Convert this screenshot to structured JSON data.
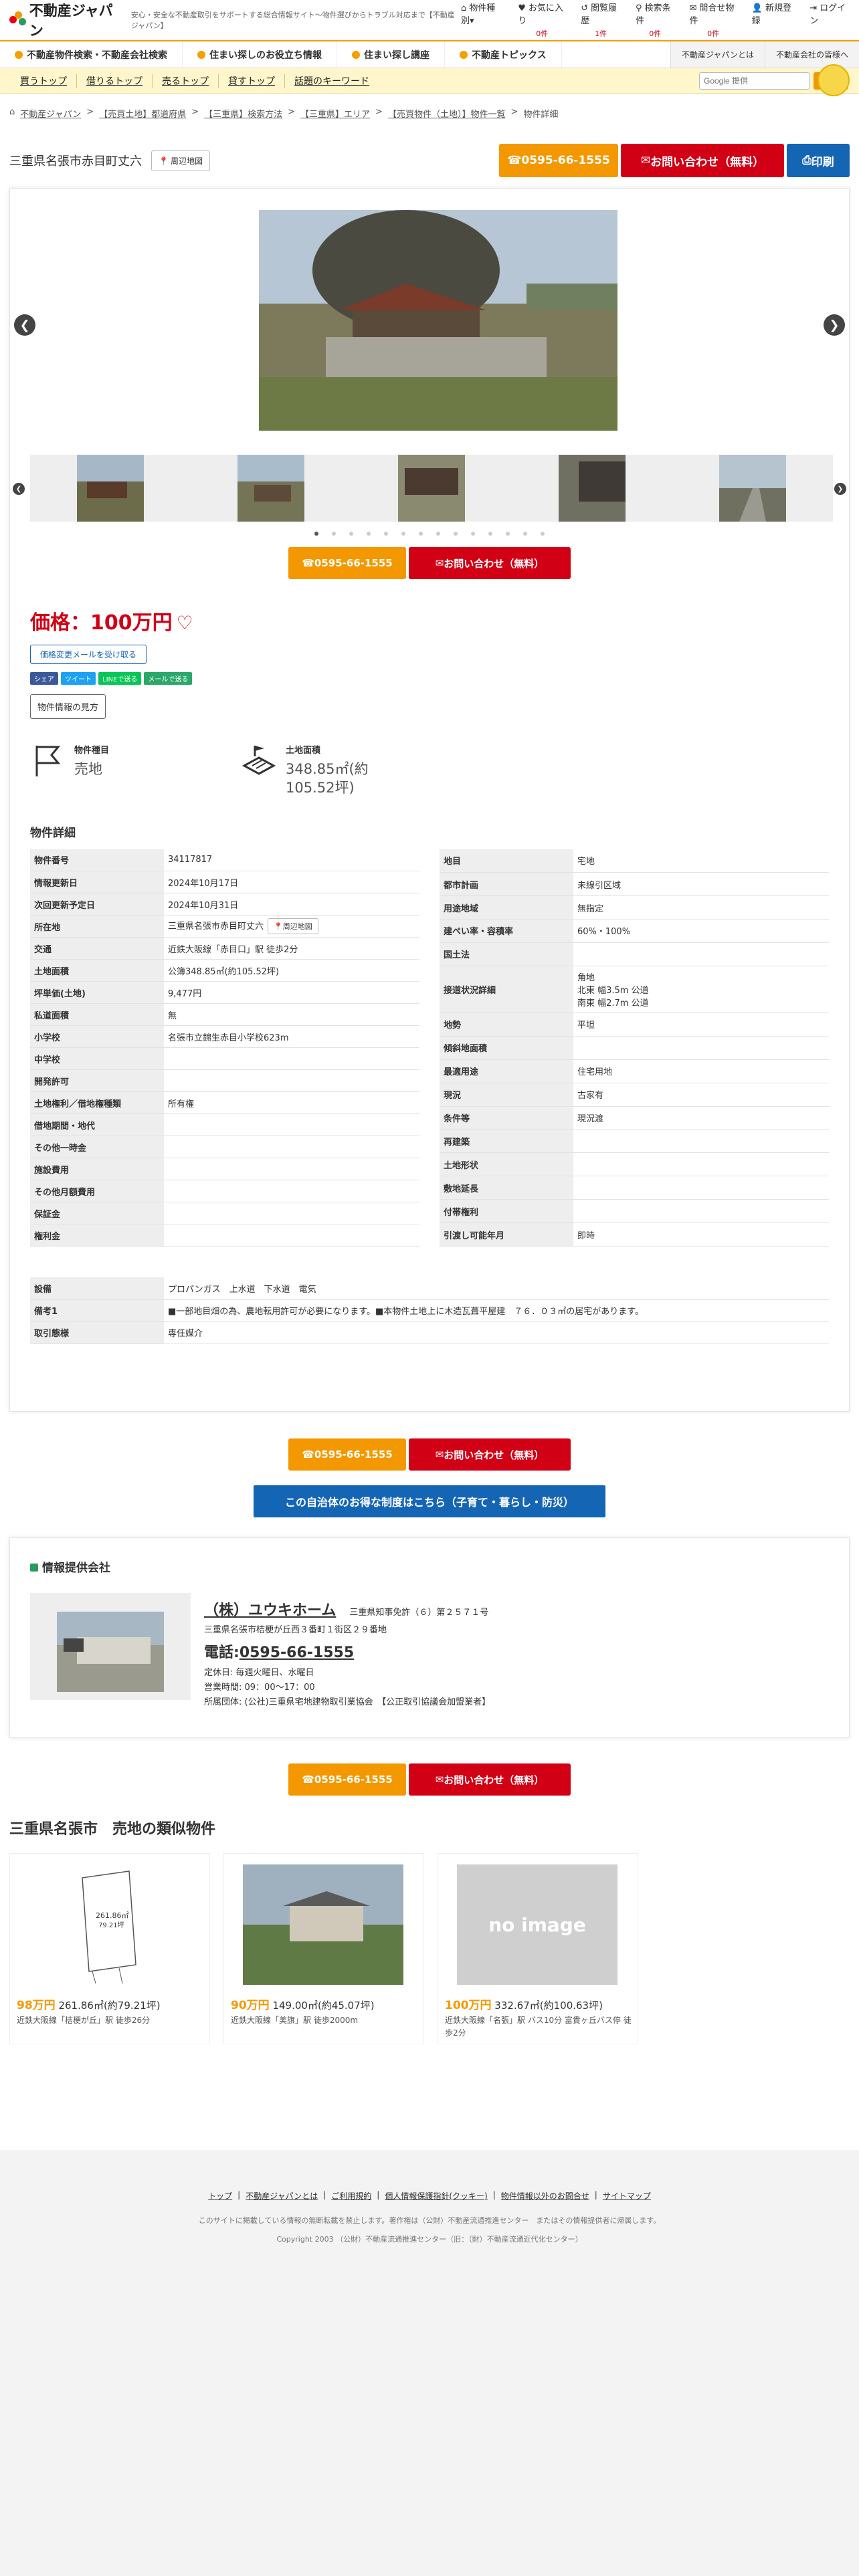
{
  "header": {
    "logo": "不動産ジャパン",
    "tagline": "安心・安全な不動産取引をサポートする総合情報サイト〜物件選びからトラブル対応まで【不動産ジャパン】",
    "utils": [
      {
        "label": "物件種別",
        "icon": "home-icon",
        "count": ""
      },
      {
        "label": "お気に入り",
        "icon": "heart-icon",
        "count": "0件"
      },
      {
        "label": "閲覧履歴",
        "icon": "history-icon",
        "count": "1件"
      },
      {
        "label": "検索条件",
        "icon": "search-icon",
        "count": "0件"
      },
      {
        "label": "問合せ物件",
        "icon": "mail-icon",
        "count": "0件"
      },
      {
        "label": "新規登録",
        "icon": "user-add-icon",
        "count": ""
      },
      {
        "label": "ログイン",
        "icon": "login-icon",
        "count": ""
      }
    ]
  },
  "nav1": {
    "items": [
      "不動産物件検索・不動産会社検索",
      "住まい探しのお役立ち情報",
      "住まい探し講座",
      "不動産トピックス"
    ],
    "right": [
      "不動産ジャパンとは",
      "不動産会社の皆様へ"
    ]
  },
  "nav2": {
    "items": [
      "買うトップ",
      "借りるトップ",
      "売るトップ",
      "貸すトップ",
      "話題のキーワード"
    ],
    "search_placeholder": "Google 提供",
    "search_button": "検索"
  },
  "breadcrumb": [
    "不動産ジャパン",
    "【売買土地】都道府県",
    "【三重県】検索方法",
    "【三重県】エリア",
    "【売買物件（土地）】物件一覧",
    "物件詳細"
  ],
  "title": {
    "address": "三重県名張市赤目町丈六",
    "map_label": "周辺地図",
    "tel_label": "0595-66-1555",
    "inquiry_label": "お問い合わせ（無料）",
    "print_label": "印刷"
  },
  "price": {
    "label": "価格：100万円",
    "change_mail": "価格変更メールを受け取る",
    "share": [
      "シェア",
      "ツイート",
      "LINEで送る",
      "メールで送る"
    ],
    "howto": "物件情報の見方"
  },
  "keyvals": [
    {
      "label": "物件種目",
      "value": "売地",
      "icon": "flag-icon"
    },
    {
      "label": "土地面積",
      "value": "348.85㎡(約105.52坪)",
      "icon": "land-area-icon"
    }
  ],
  "details_title": "物件詳細",
  "details_left": [
    {
      "k": "物件番号",
      "v": "34117817"
    },
    {
      "k": "情報更新日",
      "v": "2024年10月17日"
    },
    {
      "k": "次回更新予定日",
      "v": "2024年10月31日"
    },
    {
      "k": "所在地",
      "v": "三重県名張市赤目町丈六",
      "map": "周辺地図"
    },
    {
      "k": "交通",
      "v": "近鉄大阪線「赤目口」駅 徒歩2分"
    },
    {
      "k": "土地面積",
      "v": "公簿348.85㎡(約105.52坪)"
    },
    {
      "k": "坪単価(土地)",
      "v": "9,477円"
    },
    {
      "k": "私道面積",
      "v": "無"
    },
    {
      "k": "小学校",
      "v": "名張市立錦生赤目小学校623m"
    },
    {
      "k": "中学校",
      "v": ""
    },
    {
      "k": "開発許可",
      "v": ""
    },
    {
      "k": "土地権利／借地権種類",
      "v": "所有権"
    },
    {
      "k": "借地期間・地代",
      "v": ""
    },
    {
      "k": "その他一時金",
      "v": ""
    },
    {
      "k": "施設費用",
      "v": ""
    },
    {
      "k": "その他月額費用",
      "v": ""
    },
    {
      "k": "保証金",
      "v": ""
    },
    {
      "k": "権利金",
      "v": ""
    }
  ],
  "details_right": [
    {
      "k": "地目",
      "v": "宅地"
    },
    {
      "k": "都市計画",
      "v": "未線引区域"
    },
    {
      "k": "用途地域",
      "v": "無指定"
    },
    {
      "k": "建ぺい率・容積率",
      "v": "60%・100%"
    },
    {
      "k": "国土法",
      "v": ""
    },
    {
      "k": "接道状況詳細",
      "v": "角地",
      "v2": "北東 幅3.5m 公道",
      "v3": "南東 幅2.7m 公道"
    },
    {
      "k": "地勢",
      "v": "平坦"
    },
    {
      "k": "傾斜地面積",
      "v": ""
    },
    {
      "k": "最適用途",
      "v": "住宅用地"
    },
    {
      "k": "現況",
      "v": "古家有"
    },
    {
      "k": "条件等",
      "v": "現況渡"
    },
    {
      "k": "再建築",
      "v": ""
    },
    {
      "k": "土地形状",
      "v": ""
    },
    {
      "k": "敷地延長",
      "v": ""
    },
    {
      "k": "付帯権利",
      "v": ""
    },
    {
      "k": "引渡し可能年月",
      "v": "即時"
    }
  ],
  "details_full": [
    {
      "k": "設備",
      "v": "プロパンガス　上水道　下水道　電気"
    },
    {
      "k": "備考1",
      "v": "■一部地目畑の為、農地転用許可が必要になります。■本物件土地上に木造瓦葺平屋建　７６．０３㎡の居宅があります。"
    },
    {
      "k": "取引態様",
      "v": "専任媒介"
    }
  ],
  "welfare_button": "この自治体のお得な制度はこちら（子育て・暮らし・防災）",
  "company": {
    "heading": "情報提供会社",
    "name": "（株）ユウキホーム",
    "license": "三重県知事免許（６）第２５７１号",
    "address": "三重県名張市桔梗が丘西３番町１街区２９番地",
    "tel_prefix": "電話:",
    "tel": "0595-66-1555",
    "holiday": "定休日: 毎週火曜日、水曜日",
    "hours": "営業時間: 09：00～17：00",
    "group": "所属団体: (公社)三重県宅地建物取引業協会　【公正取引協議会加盟業者】"
  },
  "similar": {
    "heading": "三重県名張市　売地の類似物件",
    "items": [
      {
        "price": "98万円",
        "area": "261.86㎡(約79.21坪)",
        "access": "近鉄大阪線「桔梗が丘」駅 徒歩26分",
        "img": "plan"
      },
      {
        "price": "90万円",
        "area": "149.00㎡(約45.07坪)",
        "access": "近鉄大阪線「美旗」駅 徒歩2000m",
        "img": "house"
      },
      {
        "price": "100万円",
        "area": "332.67㎡(約100.63坪)",
        "access": "近鉄大阪線「名張」駅 バス10分 富貴ヶ丘バス停 徒歩2分",
        "img": "none"
      }
    ],
    "no_image": "no image",
    "plan_area_label": "261.86㎡",
    "plan_area_label2": "79.21坪"
  },
  "footer": {
    "links": [
      "トップ",
      "不動産ジャパンとは",
      "ご利用規約",
      "個人情報保護指針(クッキー)",
      "物件情報以外のお問合せ",
      "サイトマップ"
    ],
    "note": "このサイトに掲載している情報の無断転載を禁止します。著作権は（公財）不動産流通推進センター　またはその情報提供者に帰属します。",
    "copyright": "Copyright 2003 （公財）不動産流通推進センター（旧：（財）不動産流通近代化センター）"
  },
  "colors": {
    "accent": "#f39800",
    "price": "#d10015",
    "blue": "#1565b5",
    "green": "#2a9a5a"
  }
}
